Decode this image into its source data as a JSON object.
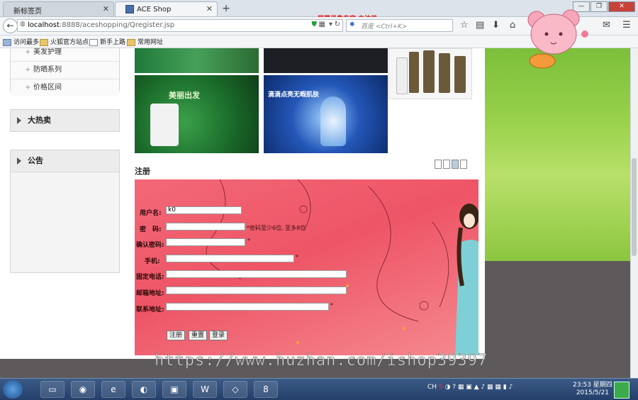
{
  "browser": {
    "tabs": [
      {
        "label": "新标签页",
        "active": false
      },
      {
        "label": "ACE Shop",
        "active": true
      }
    ],
    "new_tab": "+",
    "window_buttons": [
      "—",
      "❐",
      "✕"
    ],
    "recorder_label": "屏幕录像专家 未注册",
    "address": {
      "host": "localhost",
      "rest": ":8888/aceshopping/Qregister.jsp"
    },
    "search_placeholder": "百度 <Ctrl+K>",
    "bookmarks": [
      "访问最多",
      "火狐官方站点",
      "新手上路",
      "常用网址"
    ]
  },
  "sidebar": {
    "menu_items": [
      "美发护理",
      "防晒系列",
      "价格区间"
    ],
    "hot_title": "大热卖",
    "notice_title": "公告"
  },
  "banners": {
    "green_text": "美丽出发",
    "blue_text": "滴滴点亮无暇肌肤"
  },
  "register": {
    "title": "注册",
    "fields": [
      {
        "label": "用户名:",
        "value": "k0",
        "hint": ""
      },
      {
        "label": "密　码:",
        "value": "",
        "hint": "*密码至少6位, 至多8位"
      },
      {
        "label": "确认密码:",
        "value": "",
        "hint": "*"
      },
      {
        "label": "手机:",
        "value": "",
        "hint": "*"
      },
      {
        "label": "固定电话:",
        "value": "",
        "hint": ""
      },
      {
        "label": "邮箱地址:",
        "value": "",
        "hint": ""
      },
      {
        "label": "联系地址:",
        "value": "",
        "hint": "*"
      }
    ],
    "buttons": [
      "注册",
      "重置",
      "登录"
    ]
  },
  "watermark": "https://www.huzhan.com/ishop39397",
  "taskbar": {
    "tray_lang": "CH",
    "time": "23:53 星期四",
    "date": "2015/5/21"
  },
  "colors": {
    "form_bg": "#ee5566",
    "side_bg": "#8cc63f",
    "bottom_bg": "#5e5a5b"
  }
}
